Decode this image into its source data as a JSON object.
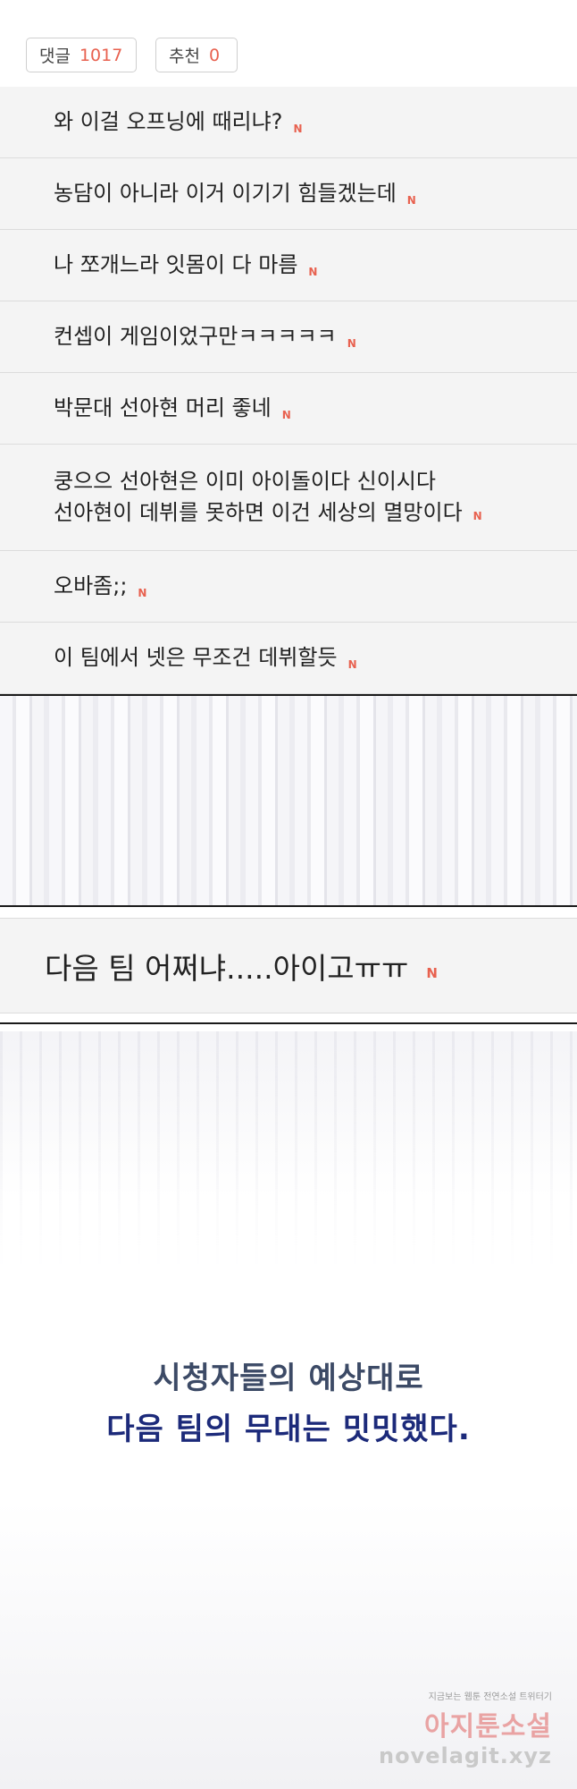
{
  "stats": {
    "comments_label": "댓글",
    "comments_count": "1017",
    "recommend_label": "추천",
    "recommend_count": "0"
  },
  "new_badge": "N",
  "comments": [
    {
      "text": "와 이걸 오프닝에 때리냐?"
    },
    {
      "text": "농담이 아니라 이거 이기기 힘들겠는데"
    },
    {
      "text": "나 쪼개느라 잇몸이 다 마름"
    },
    {
      "text": "컨셉이 게임이었구만ㅋㅋㅋㅋㅋ"
    },
    {
      "text": "박문대 선아현 머리 좋네"
    },
    {
      "text": "쿵으으 선아현은 이미 아이돌이다 신이시다\n선아현이 데뷔를 못하면 이건 세상의 멸망이다"
    },
    {
      "text": "오바좀;;"
    },
    {
      "text": "이 팀에서 넷은 무조건 데뷔할듯"
    }
  ],
  "highlight_comment": "다음 팀 어쩌냐.....아이고ㅠㅠ",
  "captions": {
    "line1": "시청자들의 예상대로",
    "line2": "다음 팀의 무대는 밋밋했다."
  },
  "watermark": {
    "small": "지금보는 웹툰 전연소설 트위터기",
    "big": "아지툰소설",
    "url": "novelagit.xyz"
  }
}
